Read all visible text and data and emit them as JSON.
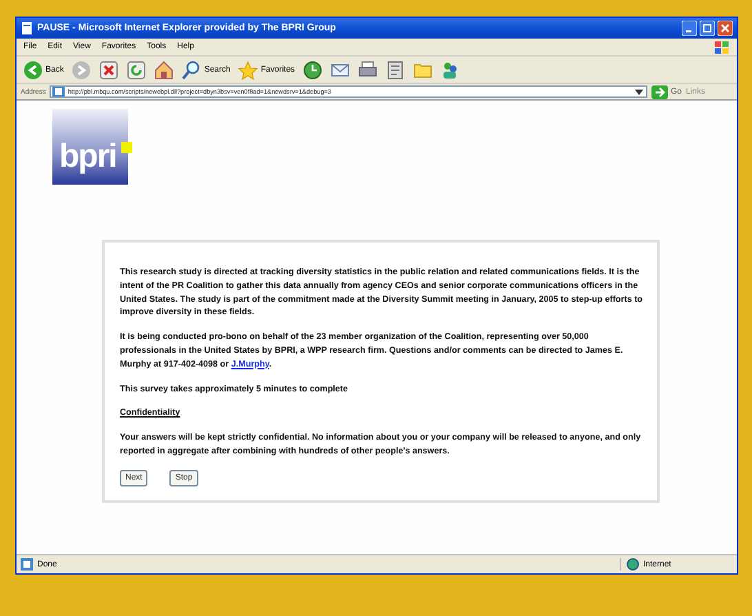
{
  "window": {
    "title": "PAUSE - Microsoft Internet Explorer provided by The BPRI Group"
  },
  "menu": [
    "File",
    "Edit",
    "View",
    "Favorites",
    "Tools",
    "Help"
  ],
  "toolbar": [
    {
      "kind": "back",
      "label": "Back"
    },
    {
      "kind": "forward"
    },
    {
      "kind": "stop"
    },
    {
      "kind": "refresh"
    },
    {
      "kind": "home"
    },
    {
      "kind": "search",
      "label": "Search"
    },
    {
      "kind": "favorites",
      "label": "Favorites"
    },
    {
      "kind": "history"
    },
    {
      "kind": "mail"
    },
    {
      "kind": "print"
    },
    {
      "kind": "edit"
    },
    {
      "kind": "folder"
    },
    {
      "kind": "messenger"
    }
  ],
  "address": {
    "label": "Address",
    "url": "http://pbl.mbqu.com/scripts/newebpl.dll?project=dbyn3bsv=ven0f8ad=1&newdsrv=1&debug=3",
    "go": "Go",
    "links": "Links"
  },
  "logo": {
    "text": "bpri"
  },
  "content": {
    "paragraphs": [
      {
        "text": "This research study is directed at tracking diversity statistics in the public relation and related communications fields. It is the intent of the PR Coalition to gather this data annually from agency CEOs and senior corporate communications officers in the United States. The study is part of the commitment made at the Diversity Summit meeting in January, 2005 to step-up efforts to improve diversity in these fields."
      },
      {
        "text": "It is being conducted pro-bono on behalf of the 23 member organization of the Coalition, representing over 50,000 professionals in the United States by BPRI, a WPP research firm. Questions and/or comments can be directed to James E. Murphy at 917-402-4098 or ",
        "link": "J.Murphy",
        "after": "."
      },
      {
        "text": "This survey takes approximately 5 minutes to complete"
      }
    ],
    "heading": "Confidentiality",
    "note": "Your answers will be kept strictly confidential. No information about you or your company will be released to anyone, and only reported in aggregate after combining with hundreds of other people's answers.",
    "buttons": [
      "Next",
      "Stop"
    ]
  },
  "status_bar": {
    "text": "Done",
    "zone": "Internet"
  }
}
